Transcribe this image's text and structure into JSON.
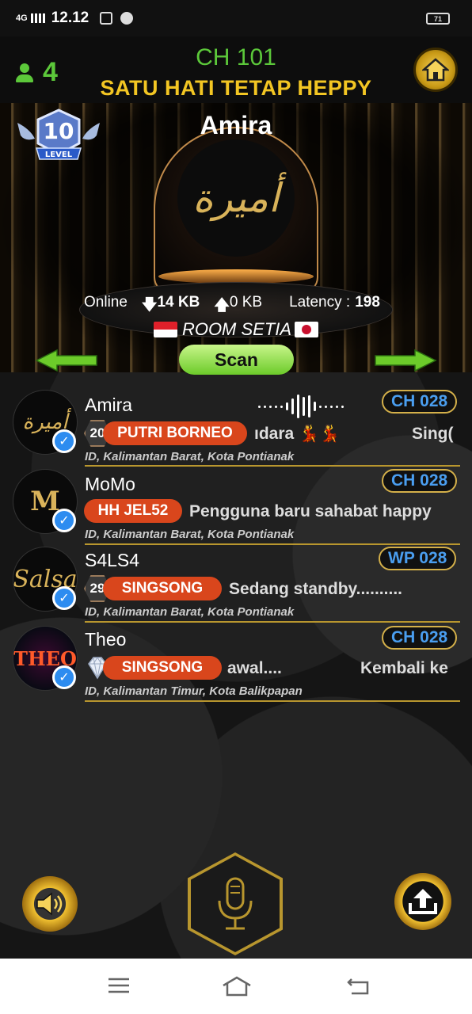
{
  "statusbar": {
    "network": "4G",
    "time": "12.12",
    "battery": "71"
  },
  "header": {
    "user_count": "4",
    "channel": "CH 101",
    "room_name": "SATU HATI TETAP HEPPY"
  },
  "stage": {
    "level_number": "10",
    "level_label": "LEVEL",
    "host_name": "Amira",
    "host_avatar_text": "أميرة",
    "online_label": "Online",
    "download": "14 KB",
    "upload": "0 KB",
    "latency_label": "Latency :",
    "latency_value": "198",
    "room_tag": "ROOM SETIA",
    "scan_label": "Scan"
  },
  "users": [
    {
      "name": "Amira",
      "channel": "CH 028",
      "level": "20",
      "role": "PUTRI BORNEO",
      "status": "ıdara 💃💃",
      "status_extra": "Sing(",
      "location": "ID, Kalimantan Barat, Kota Pontianak",
      "avatar_text": "أميرة"
    },
    {
      "name": "MoMo",
      "channel": "CH 028",
      "level": "",
      "role": "HH  JEL52",
      "status": "Pengguna baru sahabat happy",
      "status_extra": "",
      "location": "ID, Kalimantan Barat, Kota Pontianak",
      "avatar_text": "M"
    },
    {
      "name": "S4LS4",
      "channel": "WP 028",
      "level": "29",
      "role": "SINGSONG",
      "status": "Sedang standby..........",
      "status_extra": "",
      "location": "ID, Kalimantan Barat, Kota Pontianak",
      "avatar_text": "Salsa"
    },
    {
      "name": "Theo",
      "channel": "CH 028",
      "level": "",
      "role": "SINGSONG",
      "status": "awal....",
      "status_extra": "Kembali ke",
      "location": "ID, Kalimantan Timur, Kota Balikpapan",
      "avatar_text": "THEO"
    }
  ],
  "icons": {
    "user": "person-icon",
    "home": "home-icon",
    "mic": "microphone-icon",
    "speaker": "speaker-icon",
    "upload": "upload-icon",
    "diamond": "diamond-icon"
  },
  "colors": {
    "accent_green": "#5cc83a",
    "room_gold": "#f3c623",
    "channel_blue": "#4a9ef0",
    "role_orange": "#d9461c"
  }
}
